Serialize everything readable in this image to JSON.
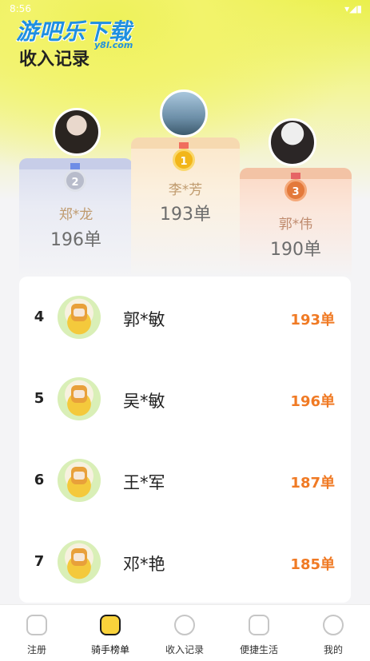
{
  "status_bar": {
    "time": "8:56",
    "right": "▾◢▮"
  },
  "watermark": {
    "text": "游吧乐下载",
    "sub": "y8l.com"
  },
  "page": {
    "title": "收入记录"
  },
  "podium": [
    {
      "rank": "2",
      "name": "郑*龙",
      "count": "196单"
    },
    {
      "rank": "1",
      "name": "李*芳",
      "count": "193单"
    },
    {
      "rank": "3",
      "name": "郭*伟",
      "count": "190单"
    }
  ],
  "list": [
    {
      "rank": "4",
      "name": "郭*敏",
      "count": "193单"
    },
    {
      "rank": "5",
      "name": "吴*敏",
      "count": "196单"
    },
    {
      "rank": "6",
      "name": "王*军",
      "count": "187单"
    },
    {
      "rank": "7",
      "name": "邓*艳",
      "count": "185单"
    }
  ],
  "tabs": [
    {
      "label": "注册",
      "icon": "home-icon"
    },
    {
      "label": "骑手榜单",
      "icon": "star-badge-icon"
    },
    {
      "label": "收入记录",
      "icon": "yen-icon"
    },
    {
      "label": "便捷生活",
      "icon": "cup-icon"
    },
    {
      "label": "我的",
      "icon": "user-icon"
    }
  ],
  "colors": {
    "accent": "#f07a24",
    "gold": "#f2b619",
    "silver": "#b8bccb",
    "bronze": "#e3793b"
  }
}
